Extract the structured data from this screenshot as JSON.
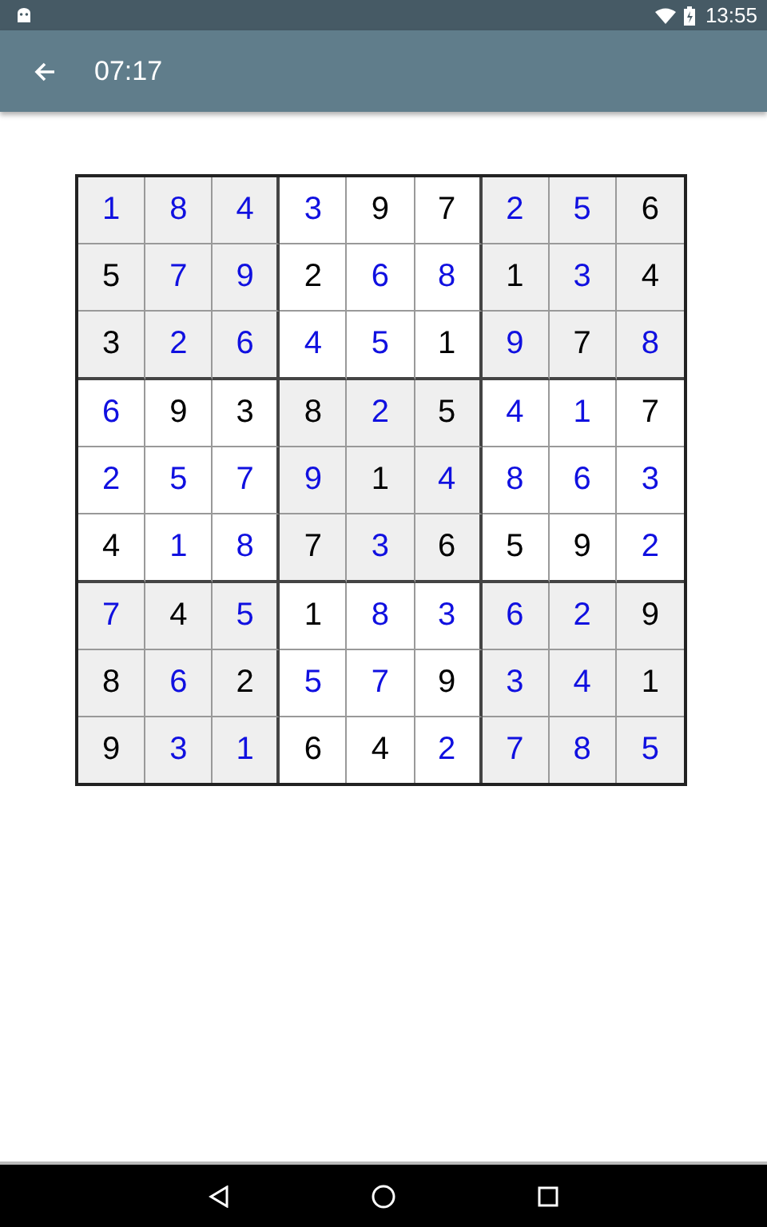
{
  "status_bar": {
    "time": "13:55"
  },
  "app_bar": {
    "title": "07:17"
  },
  "board": {
    "rows": [
      {
        "cells": [
          {
            "value": "1",
            "given": false
          },
          {
            "value": "8",
            "given": false
          },
          {
            "value": "4",
            "given": false
          },
          {
            "value": "3",
            "given": false
          },
          {
            "value": "9",
            "given": true
          },
          {
            "value": "7",
            "given": true
          },
          {
            "value": "2",
            "given": false
          },
          {
            "value": "5",
            "given": false
          },
          {
            "value": "6",
            "given": true
          }
        ]
      },
      {
        "cells": [
          {
            "value": "5",
            "given": true
          },
          {
            "value": "7",
            "given": false
          },
          {
            "value": "9",
            "given": false
          },
          {
            "value": "2",
            "given": true
          },
          {
            "value": "6",
            "given": false
          },
          {
            "value": "8",
            "given": false
          },
          {
            "value": "1",
            "given": true
          },
          {
            "value": "3",
            "given": false
          },
          {
            "value": "4",
            "given": true
          }
        ]
      },
      {
        "cells": [
          {
            "value": "3",
            "given": true
          },
          {
            "value": "2",
            "given": false
          },
          {
            "value": "6",
            "given": false
          },
          {
            "value": "4",
            "given": false
          },
          {
            "value": "5",
            "given": false
          },
          {
            "value": "1",
            "given": true
          },
          {
            "value": "9",
            "given": false
          },
          {
            "value": "7",
            "given": true
          },
          {
            "value": "8",
            "given": false
          }
        ]
      },
      {
        "cells": [
          {
            "value": "6",
            "given": false
          },
          {
            "value": "9",
            "given": true
          },
          {
            "value": "3",
            "given": true
          },
          {
            "value": "8",
            "given": true
          },
          {
            "value": "2",
            "given": false
          },
          {
            "value": "5",
            "given": true
          },
          {
            "value": "4",
            "given": false
          },
          {
            "value": "1",
            "given": false
          },
          {
            "value": "7",
            "given": true
          }
        ]
      },
      {
        "cells": [
          {
            "value": "2",
            "given": false
          },
          {
            "value": "5",
            "given": false
          },
          {
            "value": "7",
            "given": false
          },
          {
            "value": "9",
            "given": false
          },
          {
            "value": "1",
            "given": true
          },
          {
            "value": "4",
            "given": false
          },
          {
            "value": "8",
            "given": false
          },
          {
            "value": "6",
            "given": false
          },
          {
            "value": "3",
            "given": false
          }
        ]
      },
      {
        "cells": [
          {
            "value": "4",
            "given": true
          },
          {
            "value": "1",
            "given": false
          },
          {
            "value": "8",
            "given": false
          },
          {
            "value": "7",
            "given": true
          },
          {
            "value": "3",
            "given": false
          },
          {
            "value": "6",
            "given": true
          },
          {
            "value": "5",
            "given": true
          },
          {
            "value": "9",
            "given": true
          },
          {
            "value": "2",
            "given": false
          }
        ]
      },
      {
        "cells": [
          {
            "value": "7",
            "given": false
          },
          {
            "value": "4",
            "given": true
          },
          {
            "value": "5",
            "given": false
          },
          {
            "value": "1",
            "given": true
          },
          {
            "value": "8",
            "given": false
          },
          {
            "value": "3",
            "given": false
          },
          {
            "value": "6",
            "given": false
          },
          {
            "value": "2",
            "given": false
          },
          {
            "value": "9",
            "given": true
          }
        ]
      },
      {
        "cells": [
          {
            "value": "8",
            "given": true
          },
          {
            "value": "6",
            "given": false
          },
          {
            "value": "2",
            "given": true
          },
          {
            "value": "5",
            "given": false
          },
          {
            "value": "7",
            "given": false
          },
          {
            "value": "9",
            "given": true
          },
          {
            "value": "3",
            "given": false
          },
          {
            "value": "4",
            "given": false
          },
          {
            "value": "1",
            "given": true
          }
        ]
      },
      {
        "cells": [
          {
            "value": "9",
            "given": true
          },
          {
            "value": "3",
            "given": false
          },
          {
            "value": "1",
            "given": false
          },
          {
            "value": "6",
            "given": true
          },
          {
            "value": "4",
            "given": true
          },
          {
            "value": "2",
            "given": false
          },
          {
            "value": "7",
            "given": false
          },
          {
            "value": "8",
            "given": false
          },
          {
            "value": "5",
            "given": false
          }
        ]
      }
    ]
  }
}
